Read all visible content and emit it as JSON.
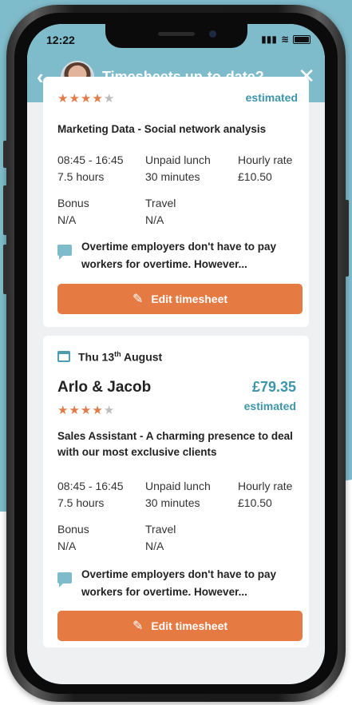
{
  "status": {
    "time": "12:22",
    "signal": "▮▮▮",
    "wifi": "≋"
  },
  "header": {
    "title": "Timesheets up-to-date?",
    "back_icon": "‹",
    "close_icon": "✕"
  },
  "card1": {
    "estimated": "estimated",
    "role": "Marketing Data - Social network analysis",
    "hours_time": "08:45 - 16:45",
    "hours_total": "7.5 hours",
    "lunch_label": "Unpaid lunch",
    "lunch_value": "30 minutes",
    "rate_label": "Hourly rate",
    "rate_value": "£10.50",
    "bonus_label": "Bonus",
    "bonus_value": "N/A",
    "travel_label": "Travel",
    "travel_value": "N/A",
    "tip": "Overtime employers don't have to pay workers for overtime. However...",
    "edit_label": "Edit timesheet",
    "rating": 4
  },
  "card2": {
    "date_main": "Thu 13",
    "date_sup": "th",
    "date_tail": " August",
    "company": "Arlo & Jacob",
    "price": "£79.35",
    "estimated": "estimated",
    "role": "Sales Assistant - A charming presence to deal with our most exclusive clients",
    "hours_time": "08:45 - 16:45",
    "hours_total": "7.5 hours",
    "lunch_label": "Unpaid lunch",
    "lunch_value": "30 minutes",
    "rate_label": "Hourly rate",
    "rate_value": "£10.50",
    "bonus_label": "Bonus",
    "bonus_value": "N/A",
    "travel_label": "Travel",
    "travel_value": "N/A",
    "tip": "Overtime employers don't have to pay workers for overtime. However...",
    "edit_label": "Edit timesheet",
    "rating": 4
  },
  "colors": {
    "teal": "#7fbccb",
    "accent_text": "#3d95ab",
    "button": "#e57a42",
    "star": "#e07a47"
  }
}
